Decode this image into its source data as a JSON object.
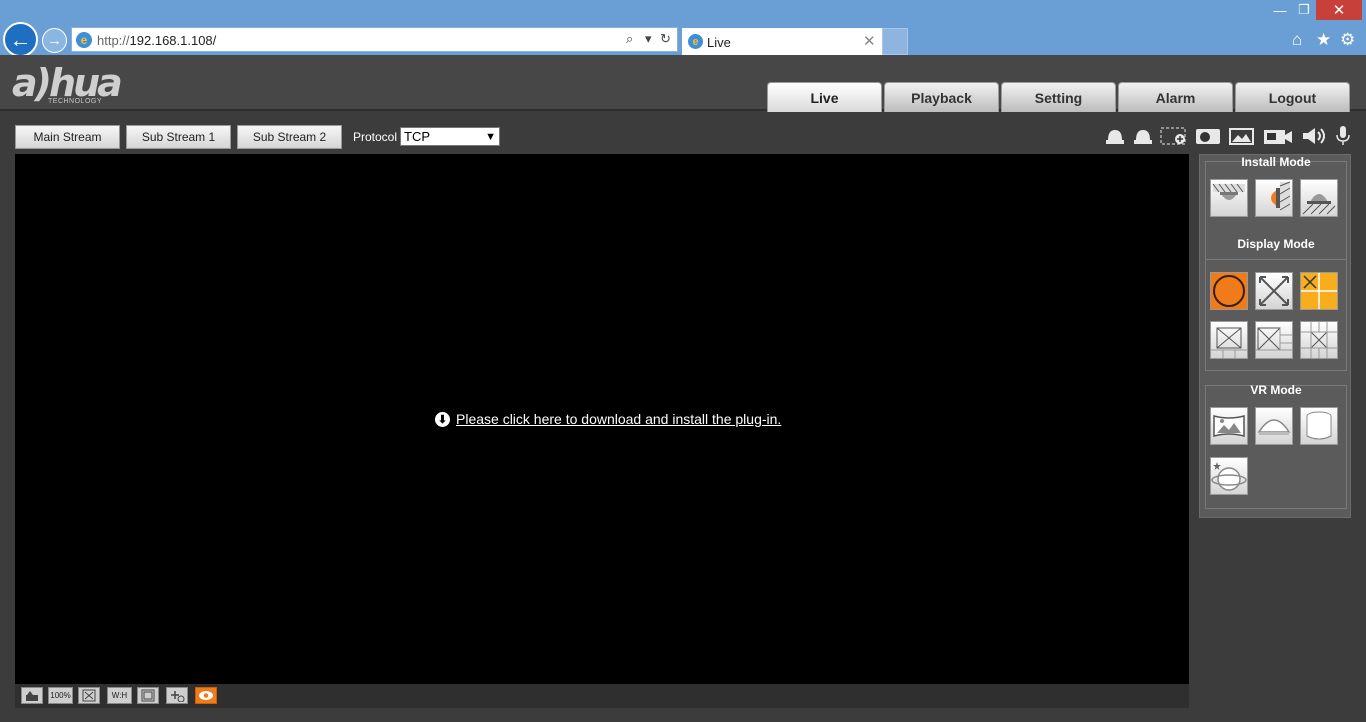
{
  "browser": {
    "url_protocol": "http://",
    "url_host": "192.168.1.108/",
    "tab_title": "Live",
    "search_glyph": "⌕",
    "dropdown_glyph": "▾",
    "refresh_glyph": "↻",
    "close_tab_glyph": "✕",
    "icons": [
      "back-icon",
      "forward-icon",
      "ie-icon",
      "home-icon",
      "star-icon",
      "gear-icon"
    ]
  },
  "app": {
    "logo_text": "a)hua",
    "logo_sub": "TECHNOLOGY",
    "nav_tabs": [
      {
        "label": "Live"
      },
      {
        "label": "Playback"
      },
      {
        "label": "Setting"
      },
      {
        "label": "Alarm"
      },
      {
        "label": "Logout"
      }
    ]
  },
  "streams": {
    "main": "Main Stream",
    "sub1": "Sub Stream 1",
    "sub2": "Sub Stream 2",
    "protocol_label": "Protocol",
    "protocol_value": "TCP"
  },
  "video": {
    "plugin_message": "Please click here to download and install the plug-in."
  },
  "video_bar": {
    "zoom_label": "100%",
    "wh_label": "W:H"
  },
  "panel": {
    "install_mode": "Install Mode",
    "display_mode": "Display Mode",
    "vr_mode": "VR Mode"
  },
  "colors": {
    "accent_orange": "#f07b1a",
    "accent_yellow": "#f8ad1c",
    "chrome_blue": "#6a9fd6"
  }
}
